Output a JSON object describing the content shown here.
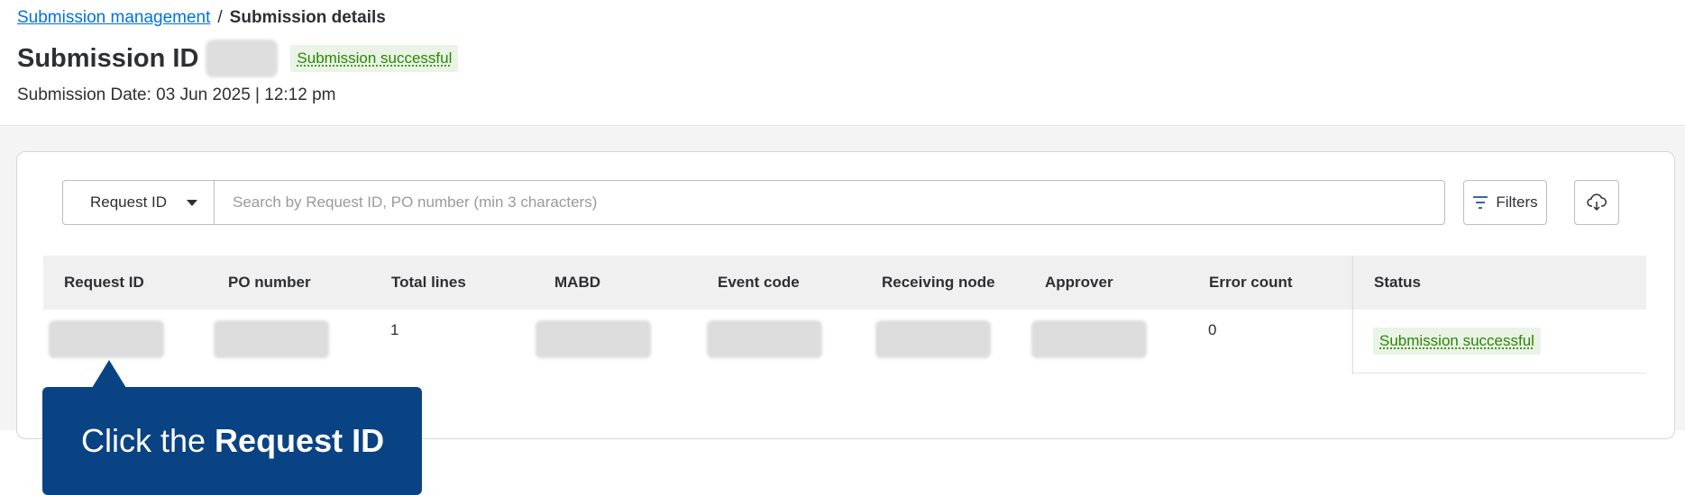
{
  "breadcrumb": {
    "parent": "Submission management",
    "separator": "/",
    "current": "Submission details"
  },
  "header": {
    "title": "Submission ID",
    "status_badge": "Submission successful",
    "submission_date": "Submission Date: 03 Jun 2025 | 12:12 pm"
  },
  "search": {
    "type_selected": "Request ID",
    "placeholder": "Search by Request ID, PO number (min 3 characters)",
    "value": ""
  },
  "toolbar": {
    "filters_label": "Filters",
    "download_icon": "cloud-download-icon",
    "filters_icon": "filter-lines-icon"
  },
  "table": {
    "columns": [
      "Request ID",
      "PO number",
      "Total lines",
      "MABD",
      "Event code",
      "Receiving node",
      "Approver",
      "Error count",
      "Status"
    ],
    "rows": [
      {
        "total_lines": "1",
        "error_count": "0",
        "status": "Submission successful"
      }
    ]
  },
  "tooltip": {
    "prefix": "Click the",
    "emphasis": "Request ID"
  },
  "colors": {
    "link": "#0071dc",
    "success_text": "#2a8703",
    "success_bg": "#eaf3e6",
    "tooltip_bg": "#0a4384"
  }
}
